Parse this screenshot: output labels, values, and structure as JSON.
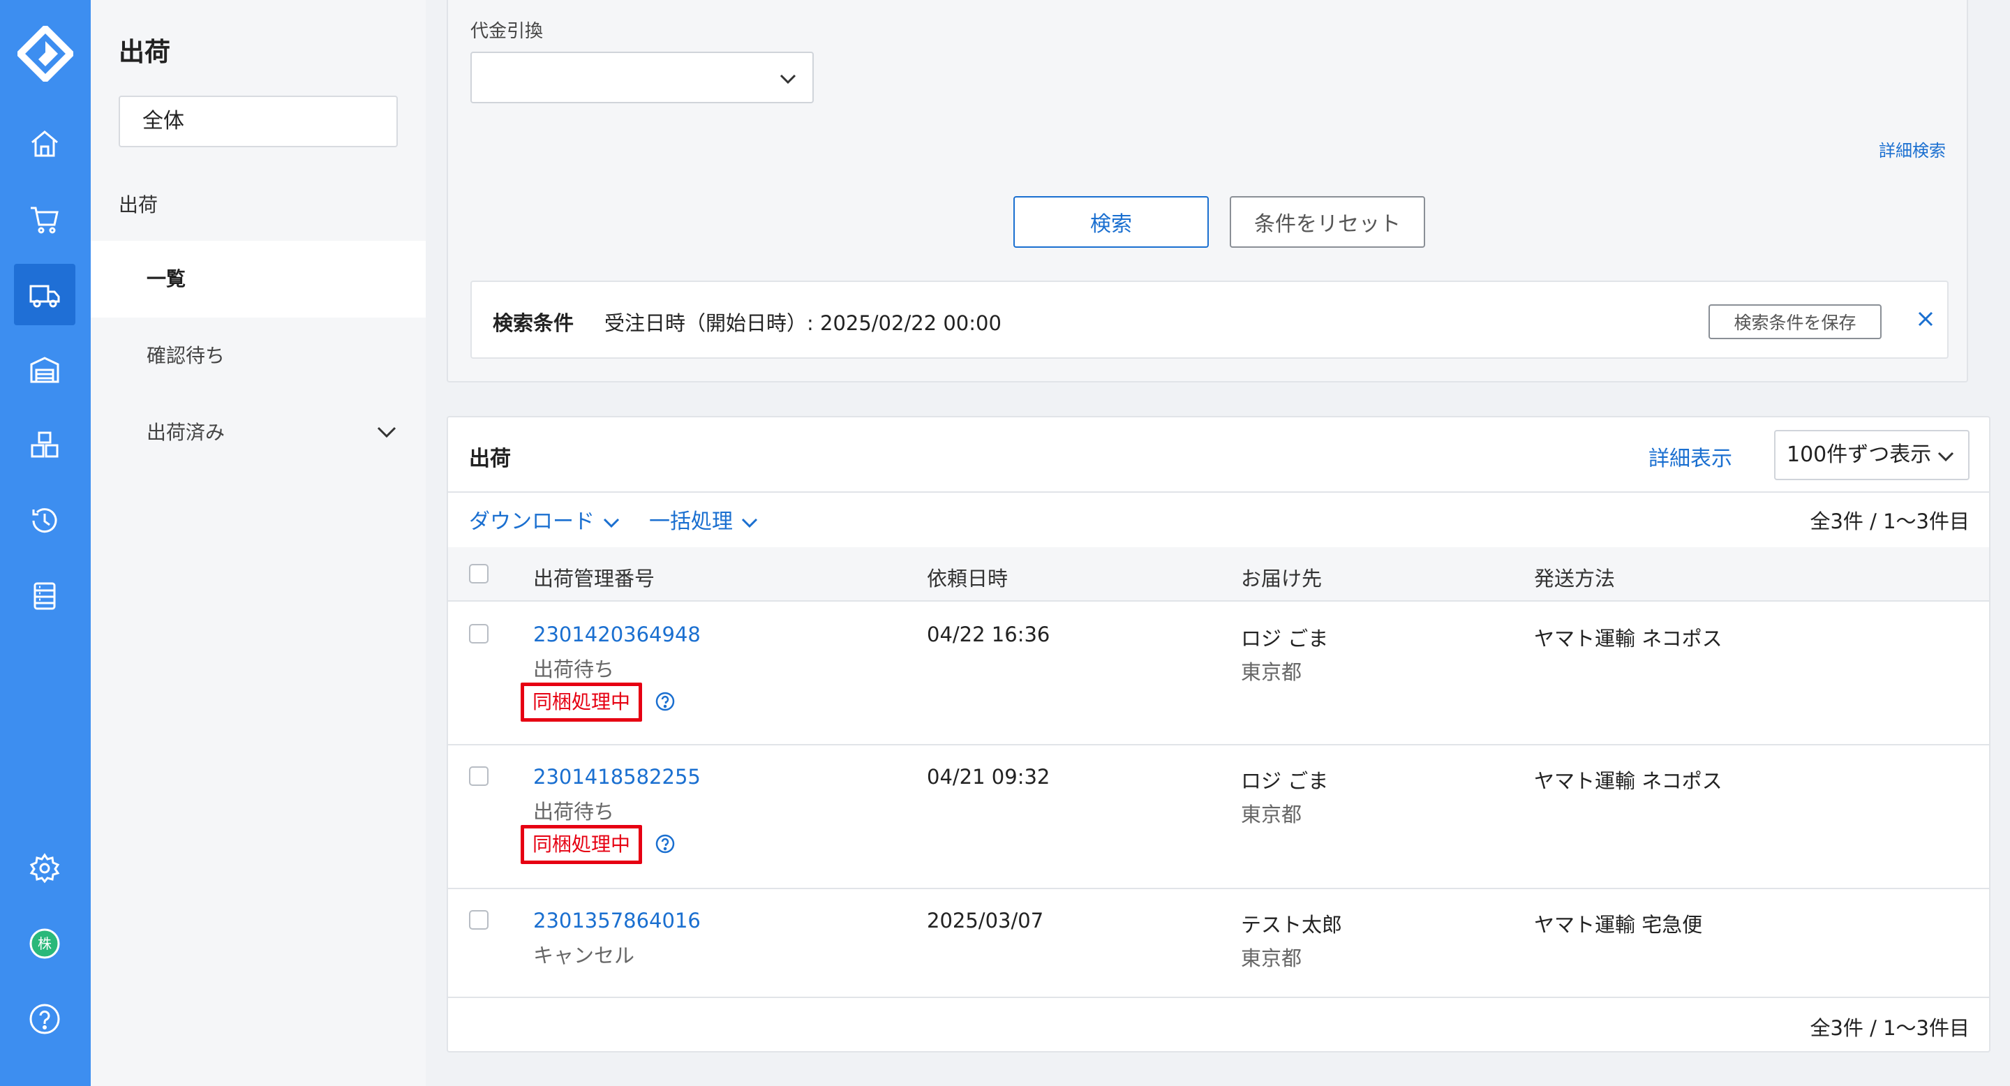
{
  "sidebar": {
    "title": "出荷",
    "scope": "全体",
    "group_label": "出荷",
    "items": [
      {
        "label": "一覧",
        "active": true
      },
      {
        "label": "確認待ち",
        "active": false
      },
      {
        "label": "出荷済み",
        "active": false
      }
    ]
  },
  "search": {
    "cod_label": "代金引換",
    "cod_value": "",
    "advanced_link": "詳細検索",
    "search_button": "検索",
    "reset_button": "条件をリセット",
    "conditions_title": "検索条件",
    "conditions_text": "受注日時（開始日時）: 2025/02/22 00:00",
    "save_conditions_button": "検索条件を保存"
  },
  "results": {
    "title": "出荷",
    "detail_view_link": "詳細表示",
    "per_page": "100件ずつ表示",
    "download_link": "ダウンロード",
    "bulk_link": "一括処理",
    "count_text": "全3件 / 1〜3件目",
    "columns": [
      "出荷管理番号",
      "依頼日時",
      "お届け先",
      "発送方法"
    ],
    "rows": [
      {
        "id": "2301420364948",
        "status": "出荷待ち",
        "badge": "同梱処理中",
        "date": "04/22 16:36",
        "recipient": "ロジ ごま",
        "prefecture": "東京都",
        "method": "ヤマト運輸 ネコポス"
      },
      {
        "id": "2301418582255",
        "status": "出荷待ち",
        "badge": "同梱処理中",
        "date": "04/21 09:32",
        "recipient": "ロジ ごま",
        "prefecture": "東京都",
        "method": "ヤマト運輸 ネコポス"
      },
      {
        "id": "2301357864016",
        "status": "キャンセル",
        "badge": "",
        "date": "2025/03/07",
        "recipient": "テスト太郎",
        "prefecture": "東京都",
        "method": "ヤマト運輸 宅急便"
      }
    ]
  },
  "rail_icons": [
    "home-icon",
    "cart-icon",
    "truck-icon",
    "warehouse-icon",
    "boxes-icon",
    "history-icon",
    "list-icon",
    "gear-icon",
    "company-badge-icon",
    "help-icon"
  ],
  "rail_badge_text": "株",
  "colors": {
    "rail": "#3d8ef0",
    "link": "#1a6fd0",
    "badge": "#e60012"
  }
}
